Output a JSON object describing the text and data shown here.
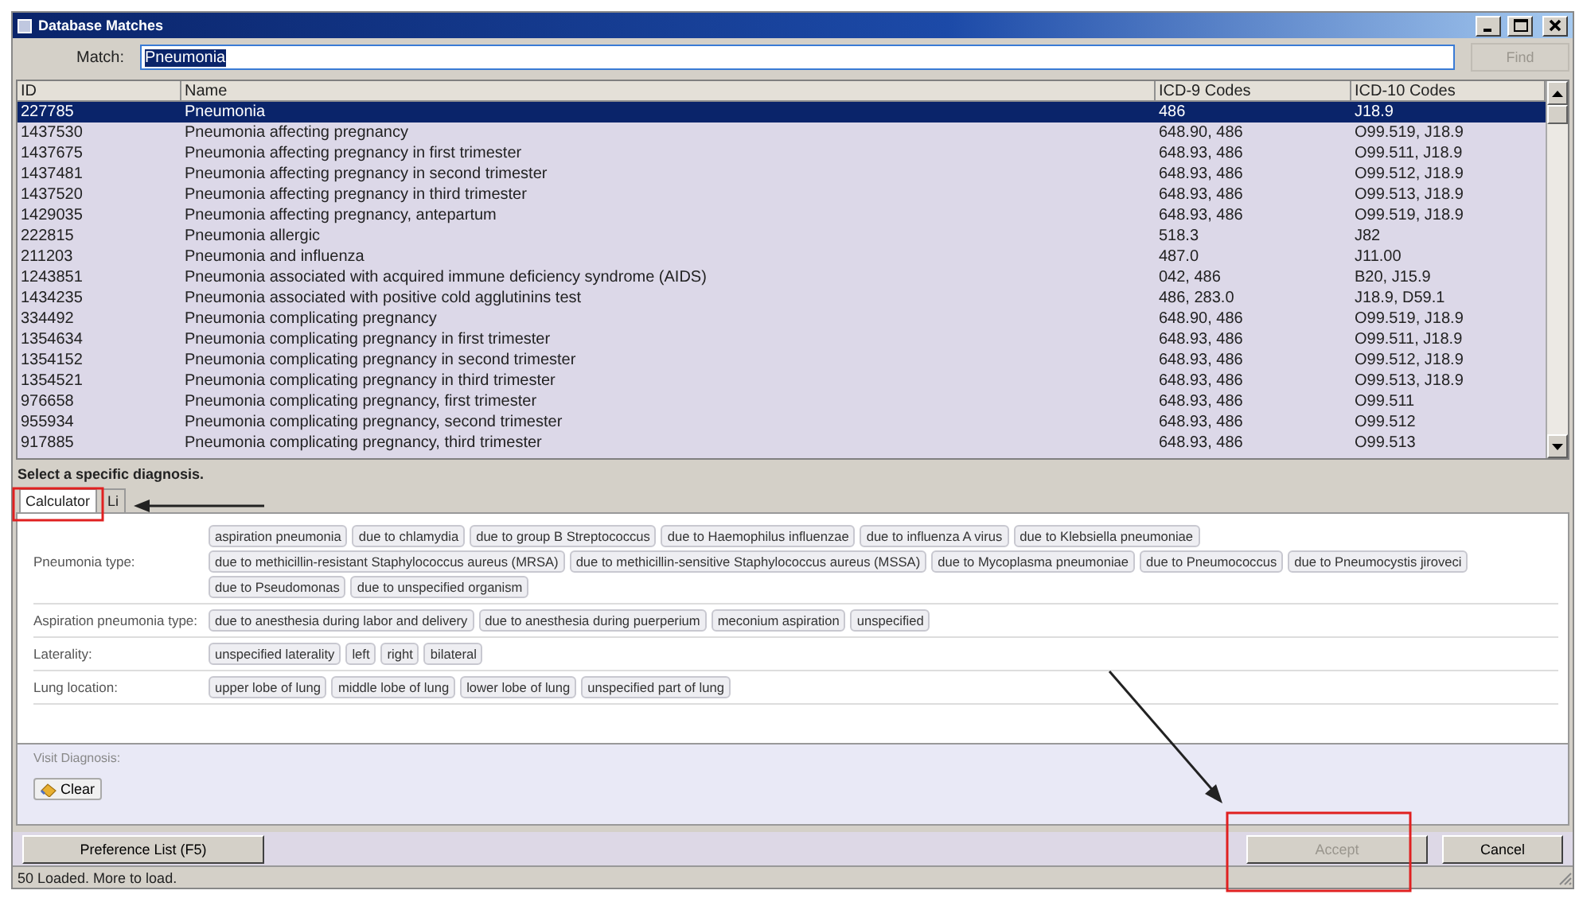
{
  "window": {
    "title": "Database Matches"
  },
  "match": {
    "label": "Match:",
    "value": "Pneumonia",
    "find_button": {
      "label": "Find",
      "disabled": true
    }
  },
  "table": {
    "columns": [
      "ID",
      "Name",
      "ICD-9 Codes",
      "ICD-10 Codes"
    ],
    "rows": [
      {
        "id": "227785",
        "name": "Pneumonia",
        "icd9": "486",
        "icd10": "J18.9",
        "selected": true
      },
      {
        "id": "1437530",
        "name": "Pneumonia affecting pregnancy",
        "icd9": "648.90, 486",
        "icd10": "O99.519, J18.9",
        "selected": false
      },
      {
        "id": "1437675",
        "name": "Pneumonia affecting pregnancy in first trimester",
        "icd9": "648.93, 486",
        "icd10": "O99.511, J18.9",
        "selected": false
      },
      {
        "id": "1437481",
        "name": "Pneumonia affecting pregnancy in second trimester",
        "icd9": "648.93, 486",
        "icd10": "O99.512, J18.9",
        "selected": false
      },
      {
        "id": "1437520",
        "name": "Pneumonia affecting pregnancy in third trimester",
        "icd9": "648.93, 486",
        "icd10": "O99.513, J18.9",
        "selected": false
      },
      {
        "id": "1429035",
        "name": "Pneumonia affecting pregnancy, antepartum",
        "icd9": "648.93, 486",
        "icd10": "O99.519, J18.9",
        "selected": false
      },
      {
        "id": "222815",
        "name": "Pneumonia allergic",
        "icd9": "518.3",
        "icd10": "J82",
        "selected": false
      },
      {
        "id": "211203",
        "name": "Pneumonia and influenza",
        "icd9": "487.0",
        "icd10": "J11.00",
        "selected": false
      },
      {
        "id": "1243851",
        "name": "Pneumonia associated with acquired immune deficiency syndrome (AIDS)",
        "icd9": "042, 486",
        "icd10": "B20, J15.9",
        "selected": false
      },
      {
        "id": "1434235",
        "name": "Pneumonia associated with positive cold agglutinins test",
        "icd9": "486, 283.0",
        "icd10": "J18.9, D59.1",
        "selected": false
      },
      {
        "id": "334492",
        "name": "Pneumonia complicating pregnancy",
        "icd9": "648.90, 486",
        "icd10": "O99.519, J18.9",
        "selected": false
      },
      {
        "id": "1354634",
        "name": "Pneumonia complicating pregnancy in first trimester",
        "icd9": "648.93, 486",
        "icd10": "O99.511, J18.9",
        "selected": false
      },
      {
        "id": "1354152",
        "name": "Pneumonia complicating pregnancy in second trimester",
        "icd9": "648.93, 486",
        "icd10": "O99.512, J18.9",
        "selected": false
      },
      {
        "id": "1354521",
        "name": "Pneumonia complicating pregnancy in third trimester",
        "icd9": "648.93, 486",
        "icd10": "O99.513, J18.9",
        "selected": false
      },
      {
        "id": "976658",
        "name": "Pneumonia complicating pregnancy, first trimester",
        "icd9": "648.93, 486",
        "icd10": "O99.511",
        "selected": false
      },
      {
        "id": "955934",
        "name": "Pneumonia complicating pregnancy, second trimester",
        "icd9": "648.93, 486",
        "icd10": "O99.512",
        "selected": false
      },
      {
        "id": "917885",
        "name": "Pneumonia complicating pregnancy, third trimester",
        "icd9": "648.93, 486",
        "icd10": "O99.513",
        "selected": false
      }
    ]
  },
  "prompt": "Select a specific diagnosis.",
  "tabs": [
    {
      "label": "Calculator",
      "selected": true
    },
    {
      "label": "Li",
      "selected": false
    }
  ],
  "calculator": [
    {
      "label": "Pneumonia type:",
      "options": [
        "aspiration pneumonia",
        "due to chlamydia",
        "due to group B Streptococcus",
        "due to Haemophilus influenzae",
        "due to influenza A virus",
        "due to Klebsiella pneumoniae",
        "due to methicillin-resistant Staphylococcus aureus (MRSA)",
        "due to methicillin-sensitive Staphylococcus aureus (MSSA)",
        "due to Mycoplasma pneumoniae",
        "due to Pneumococcus",
        "due to Pneumocystis jiroveci",
        "due to Pseudomonas",
        "due to unspecified organism"
      ]
    },
    {
      "label": "Aspiration pneumonia type:",
      "options": [
        "due to anesthesia during labor and delivery",
        "due to anesthesia during puerperium",
        "meconium aspiration",
        "unspecified"
      ]
    },
    {
      "label": "Laterality:",
      "options": [
        "unspecified laterality",
        "left",
        "right",
        "bilateral"
      ]
    },
    {
      "label": "Lung location:",
      "options": [
        "upper lobe of lung",
        "middle lobe of lung",
        "lower lobe of lung",
        "unspecified part of lung"
      ]
    }
  ],
  "visit_diagnosis": {
    "label": "Visit Diagnosis:",
    "clear_button": {
      "label": "Clear"
    }
  },
  "buttons": [
    {
      "label": "Preference List (F5)",
      "disabled": false
    },
    {
      "label": "Accept",
      "disabled": true
    },
    {
      "label": "Cancel",
      "disabled": false
    }
  ],
  "status_bar": "50 Loaded. More to load."
}
